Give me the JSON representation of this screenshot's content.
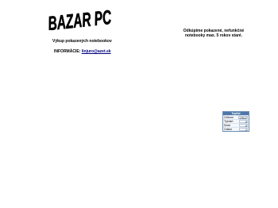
{
  "logo": {
    "text": "BAZAR PC",
    "color": "#000000"
  },
  "subtitle": "Výkup pokazených notebookov",
  "info": {
    "label": "INFORMÁCIE:",
    "email": "linjuro@azet.sk"
  },
  "notice": {
    "line1": "Odkúpime pokazené, nefunkčné",
    "line2": "notebooky max. 5 rokov staré."
  },
  "counter": {
    "title": "Toplist",
    "rows": [
      {
        "label": "Celkom",
        "value": "17517"
      },
      {
        "label": "Týždeň",
        "value": "0"
      },
      {
        "label": "Dnes",
        "value": "0"
      },
      {
        "label": "Online",
        "value": "1"
      }
    ],
    "accent": "#4d78a8"
  }
}
